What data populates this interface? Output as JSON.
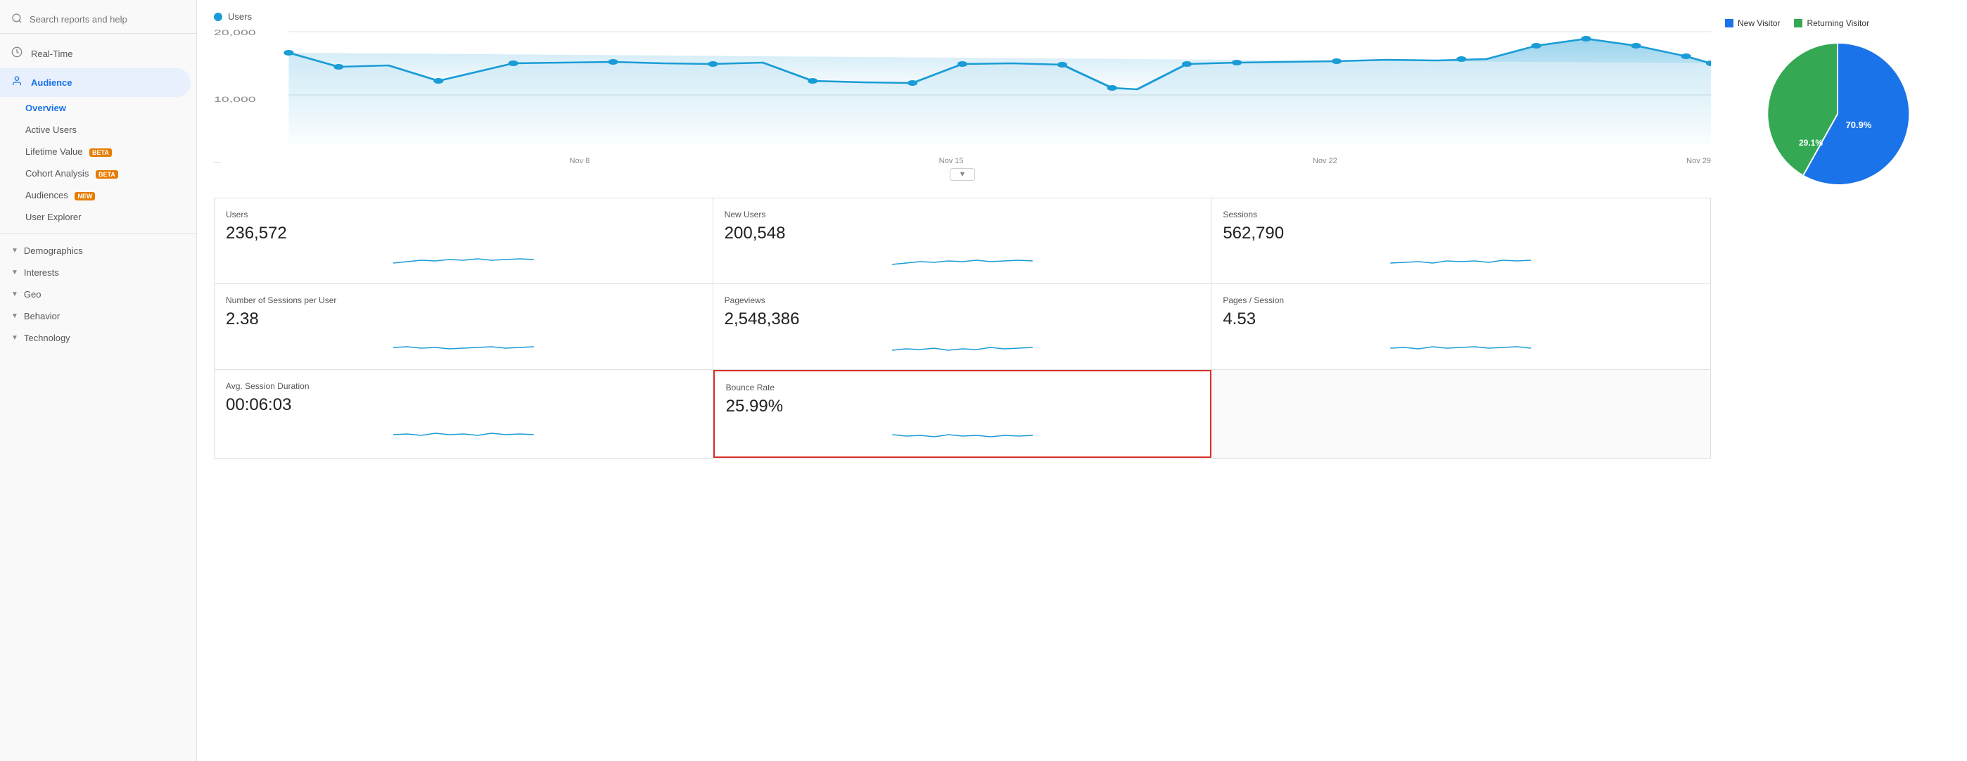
{
  "sidebar": {
    "search_placeholder": "Search reports and help",
    "items": [
      {
        "id": "realtime",
        "label": "Real-Time",
        "icon": "⏱"
      },
      {
        "id": "audience",
        "label": "Audience",
        "icon": "👤",
        "active": true
      }
    ],
    "sub_items": [
      {
        "id": "overview",
        "label": "Overview",
        "active": true
      },
      {
        "id": "active-users",
        "label": "Active Users",
        "active": false
      },
      {
        "id": "lifetime-value",
        "label": "Lifetime Value",
        "badge": "BETA",
        "badge_type": "beta"
      },
      {
        "id": "cohort-analysis",
        "label": "Cohort Analysis",
        "badge": "BETA",
        "badge_type": "beta"
      },
      {
        "id": "audiences",
        "label": "Audiences",
        "badge": "NEW",
        "badge_type": "new"
      },
      {
        "id": "user-explorer",
        "label": "User Explorer"
      }
    ],
    "collapsibles": [
      {
        "id": "demographics",
        "label": "Demographics"
      },
      {
        "id": "interests",
        "label": "Interests"
      },
      {
        "id": "geo",
        "label": "Geo"
      },
      {
        "id": "behavior",
        "label": "Behavior"
      },
      {
        "id": "technology",
        "label": "Technology"
      }
    ]
  },
  "chart": {
    "series_label": "Users",
    "series_color": "#1a9cd6",
    "y_labels": [
      "20,000",
      "10,000"
    ],
    "x_labels": [
      "...",
      "Nov 8",
      "Nov 15",
      "Nov 22",
      "Nov 29"
    ],
    "collapse_icon": "▼"
  },
  "metrics": [
    {
      "id": "users",
      "label": "Users",
      "value": "236,572"
    },
    {
      "id": "new-users",
      "label": "New Users",
      "value": "200,548"
    },
    {
      "id": "sessions",
      "label": "Sessions",
      "value": "562,790"
    },
    {
      "id": "sessions-per-user",
      "label": "Number of Sessions per User",
      "value": "2.38"
    },
    {
      "id": "pageviews",
      "label": "Pageviews",
      "value": "2,548,386"
    },
    {
      "id": "pages-per-session",
      "label": "Pages / Session",
      "value": "4.53"
    },
    {
      "id": "avg-session",
      "label": "Avg. Session Duration",
      "value": "00:06:03"
    },
    {
      "id": "bounce-rate",
      "label": "Bounce Rate",
      "value": "25.99%",
      "highlighted": true
    }
  ],
  "pie": {
    "new_visitor_label": "New Visitor",
    "returning_visitor_label": "Returning Visitor",
    "new_visitor_color": "#1a73e8",
    "returning_visitor_color": "#34a853",
    "new_visitor_pct": 70.9,
    "returning_visitor_pct": 29.1,
    "new_visitor_pct_label": "70.9%",
    "returning_visitor_pct_label": "29.1%"
  }
}
